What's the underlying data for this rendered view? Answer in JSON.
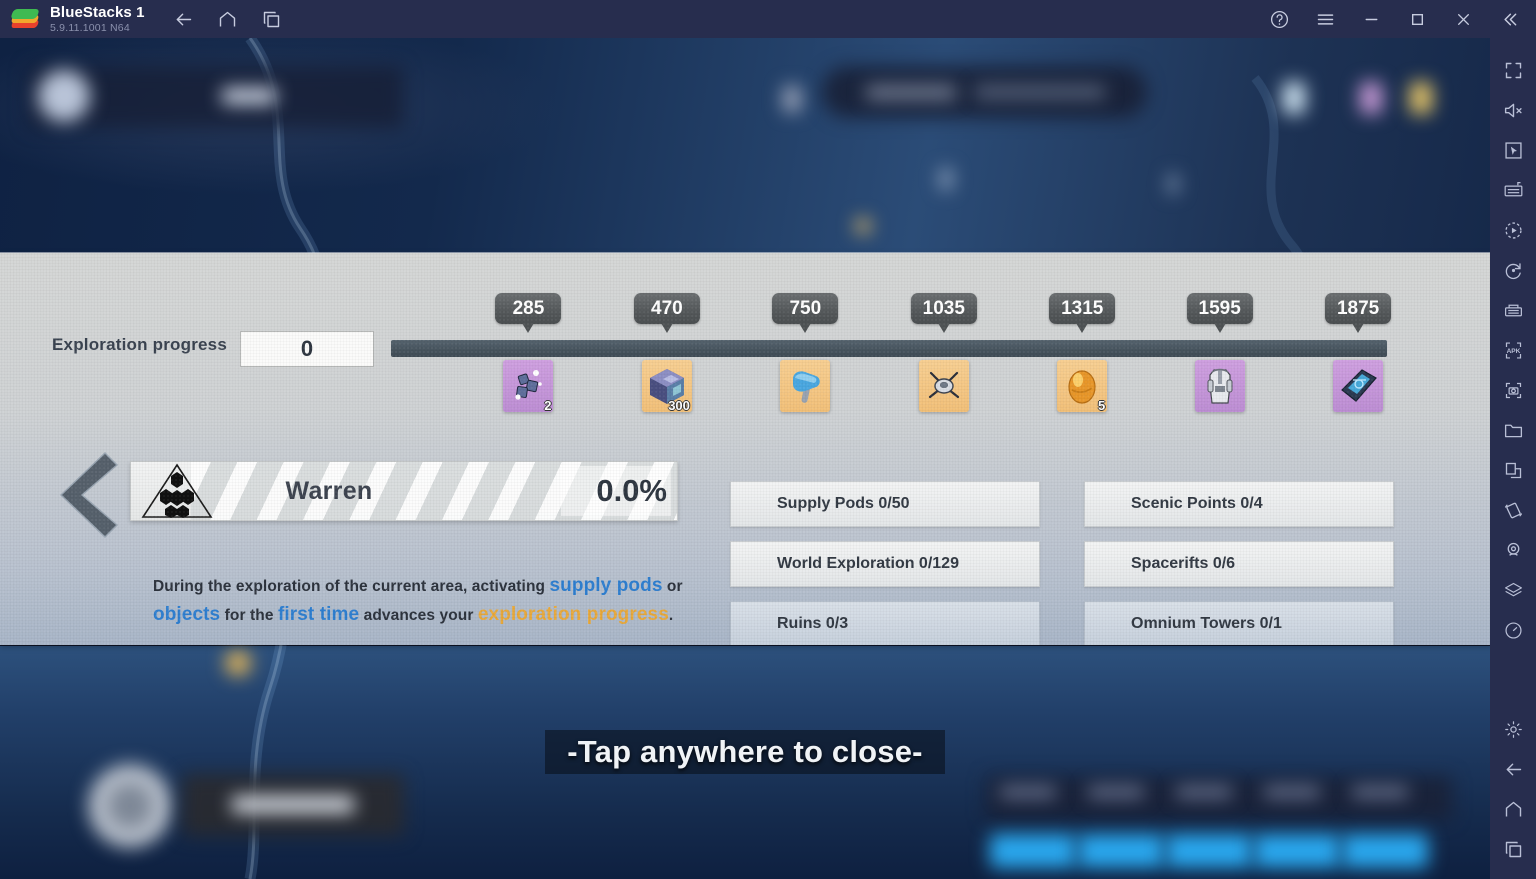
{
  "window": {
    "app_title": "BlueStacks 1",
    "version": "5.9.11.1001  N64",
    "nav": [
      {
        "name": "back-button",
        "icon": "arrow-left-icon"
      },
      {
        "name": "home-button",
        "icon": "home-icon"
      },
      {
        "name": "recents-button",
        "icon": "recents-icon"
      }
    ],
    "controls": [
      {
        "name": "help-button",
        "icon": "question-circle-icon"
      },
      {
        "name": "menu-button",
        "icon": "hamburger-icon"
      },
      {
        "name": "minimize-button",
        "icon": "minimize-icon"
      },
      {
        "name": "maximize-button",
        "icon": "maximize-icon"
      },
      {
        "name": "close-button",
        "icon": "close-icon"
      },
      {
        "name": "collapse-sidebar-button",
        "icon": "chevrons-left-icon"
      }
    ]
  },
  "sidebar": {
    "top_items": [
      {
        "name": "fullscreen-icon"
      },
      {
        "name": "mute-icon"
      },
      {
        "name": "cursor-pointer-icon"
      },
      {
        "name": "keyboard-controls-icon"
      },
      {
        "name": "macro-record-icon"
      },
      {
        "name": "rotate-icon"
      },
      {
        "name": "multi-instance-icon"
      },
      {
        "name": "install-apk-icon"
      },
      {
        "name": "screenshot-icon"
      },
      {
        "name": "media-folder-icon"
      },
      {
        "name": "copy-icon"
      },
      {
        "name": "shake-icon"
      },
      {
        "name": "location-icon"
      },
      {
        "name": "layers-icon"
      },
      {
        "name": "performance-icon"
      }
    ],
    "bottom_items": [
      {
        "name": "settings-gear-icon"
      },
      {
        "name": "back-icon"
      },
      {
        "name": "home-icon"
      },
      {
        "name": "recents-icon"
      }
    ]
  },
  "panel": {
    "exploration_label": "Exploration progress",
    "exploration_value": "0",
    "milestones": [
      {
        "value": "285",
        "pos_pct": 13.8,
        "reward_qty": "2",
        "rarity": "purple",
        "icon": "crystal-shards-icon"
      },
      {
        "value": "470",
        "pos_pct": 27.7,
        "reward_qty": "300",
        "rarity": "orange",
        "icon": "ore-cube-icon"
      },
      {
        "value": "750",
        "pos_pct": 41.6,
        "reward_qty": "",
        "rarity": "orange",
        "icon": "hammer-icon"
      },
      {
        "value": "1035",
        "pos_pct": 55.5,
        "reward_qty": "",
        "rarity": "orange",
        "icon": "drone-icon"
      },
      {
        "value": "1315",
        "pos_pct": 69.4,
        "reward_qty": "5",
        "rarity": "orange",
        "icon": "golden-egg-icon"
      },
      {
        "value": "1595",
        "pos_pct": 83.2,
        "reward_qty": "",
        "rarity": "purple",
        "icon": "suit-icon"
      },
      {
        "value": "1875",
        "pos_pct": 97.1,
        "reward_qty": "",
        "rarity": "purple",
        "icon": "blueprint-icon"
      }
    ],
    "region": {
      "name": "Warren",
      "percent": "0.0%",
      "emblem": "hex-cluster-triangle-icon"
    },
    "help_button_label": "?",
    "hint": {
      "part1": "During the exploration of the current area, activating ",
      "highlight1": "supply pods",
      "part2": " or ",
      "highlight2": "objects",
      "part3": " for the ",
      "highlight3": "first time",
      "part4": " advances your ",
      "highlight4": "exploration progress",
      "part5": "."
    },
    "categories": [
      [
        {
          "label": "Supply Pods 0/50",
          "dim": false
        },
        {
          "label": "Scenic Points 0/4",
          "dim": false
        }
      ],
      [
        {
          "label": "World Exploration 0/129",
          "dim": false
        },
        {
          "label": "Spacerifts 0/6",
          "dim": false
        }
      ],
      [
        {
          "label": "Ruins 0/3",
          "dim": true
        },
        {
          "label": "Omnium Towers 0/1",
          "dim": true
        }
      ]
    ]
  },
  "overlay": {
    "tap_to_close": "-Tap anywhere to close-"
  },
  "colors": {
    "chrome": "#272d4e",
    "accent_blue": "#2f7fd0",
    "accent_gold": "#e8a93c",
    "panel_light": "#d5d7d6",
    "track": "#4b5760"
  }
}
